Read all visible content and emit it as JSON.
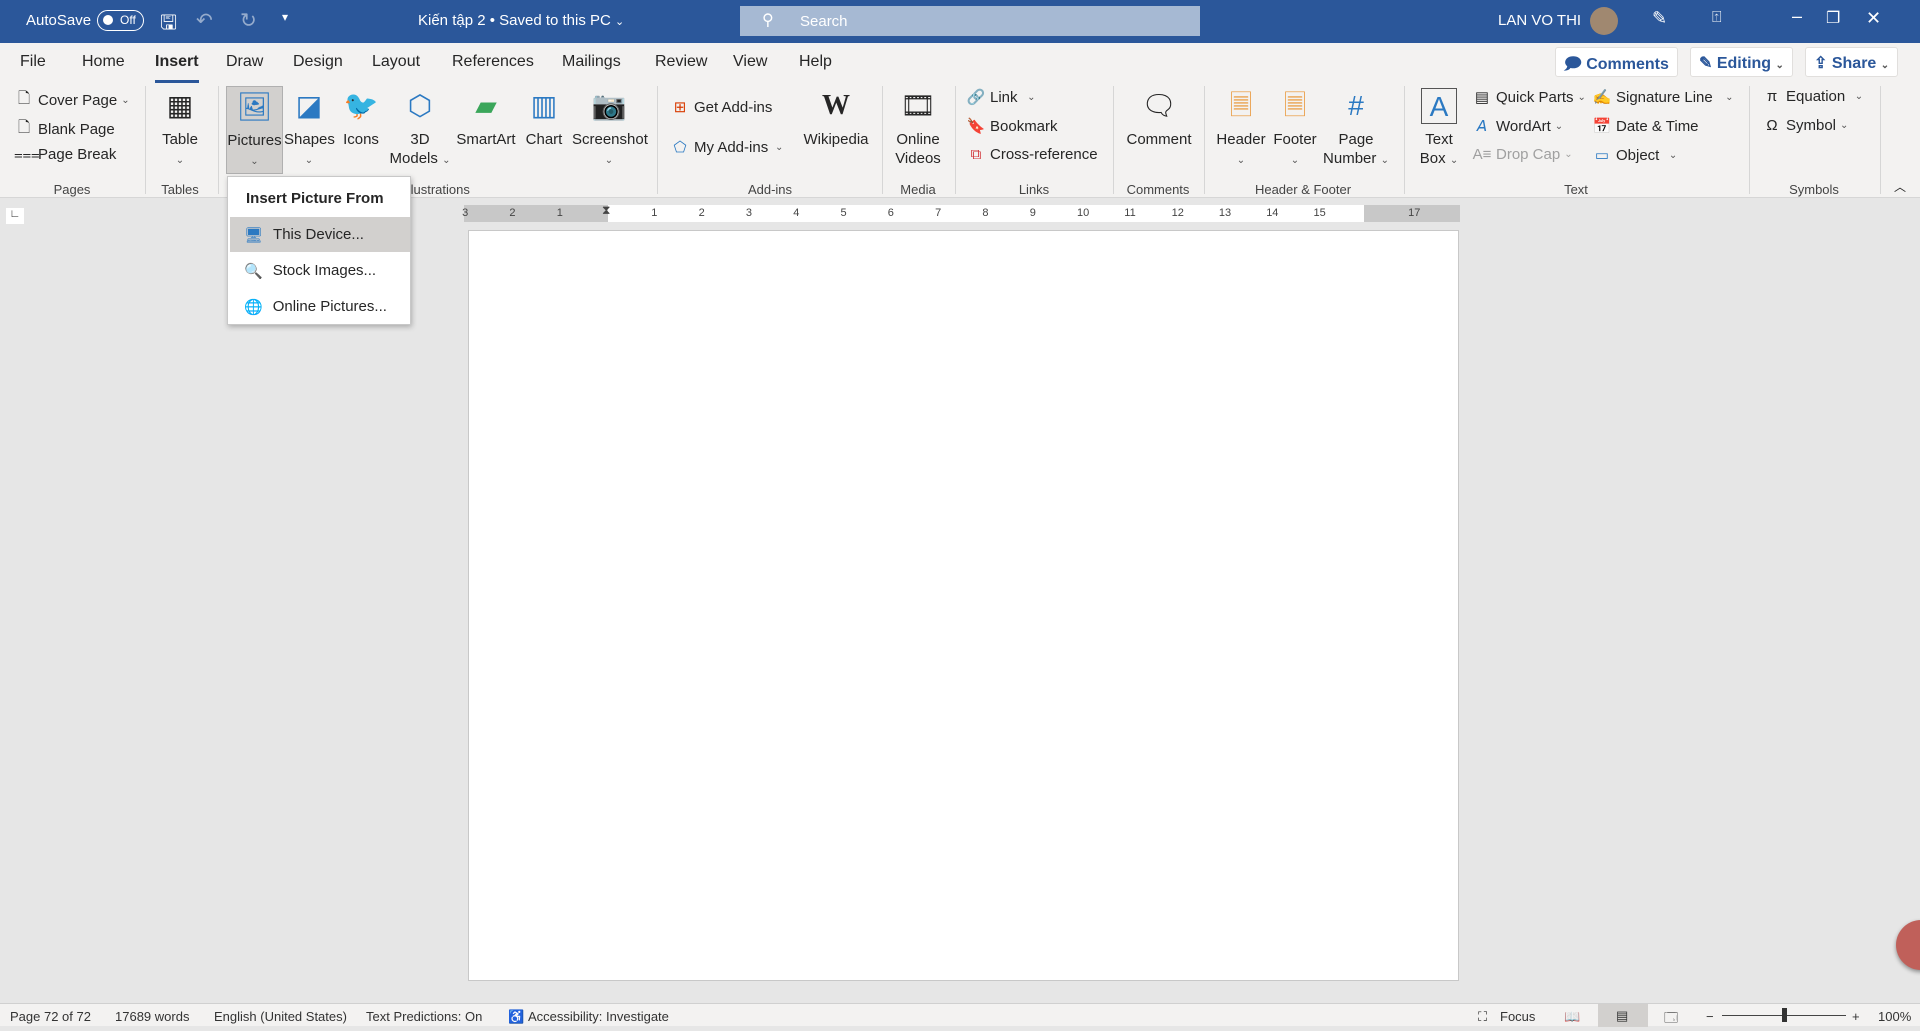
{
  "titlebar": {
    "autosave": "AutoSave",
    "autosave_state": "Off",
    "doc_title": "Kiến tập 2 • Saved to this PC",
    "search_placeholder": "Search",
    "user": "LAN VO THI",
    "color": "#2b579a"
  },
  "tabs": [
    "File",
    "Home",
    "Insert",
    "Draw",
    "Design",
    "Layout",
    "References",
    "Mailings",
    "Review",
    "View",
    "Help"
  ],
  "active_tab": "Insert",
  "top_buttons": {
    "comments": "Comments",
    "editing": "Editing",
    "share": "Share"
  },
  "ribbon": {
    "pages": {
      "label": "Pages",
      "cover": "Cover Page",
      "blank": "Blank Page",
      "break": "Page Break"
    },
    "tables": {
      "label": "Tables",
      "table": "Table"
    },
    "illustrations": {
      "label": "Illustrations",
      "pictures": "Pictures",
      "shapes": "Shapes",
      "icons": "Icons",
      "models_1": "3D",
      "models_2": "Models",
      "smartart": "SmartArt",
      "chart": "Chart",
      "screenshot": "Screenshot"
    },
    "addins": {
      "label": "Add-ins",
      "get": "Get Add-ins",
      "my": "My Add-ins",
      "wikipedia": "Wikipedia"
    },
    "media": {
      "label": "Media",
      "online_1": "Online",
      "online_2": "Videos"
    },
    "links": {
      "label": "Links",
      "link": "Link",
      "bookmark": "Bookmark",
      "cross": "Cross-reference"
    },
    "comments": {
      "label": "Comments",
      "comment": "Comment"
    },
    "header_footer": {
      "label": "Header & Footer",
      "header": "Header",
      "footer": "Footer",
      "page_1": "Page",
      "page_2": "Number"
    },
    "text": {
      "label": "Text",
      "textbox_1": "Text",
      "textbox_2": "Box",
      "quick_parts": "Quick Parts",
      "wordart": "WordArt",
      "drop_cap": "Drop Cap",
      "signature": "Signature Line",
      "datetime": "Date & Time",
      "object": "Object"
    },
    "symbols": {
      "label": "Symbols",
      "equation": "Equation",
      "symbol": "Symbol"
    }
  },
  "menu": {
    "title": "Insert Picture From",
    "items": [
      "This Device...",
      "Stock Images...",
      "Online Pictures..."
    ]
  },
  "ruler": [
    "3",
    "2",
    "1",
    "1",
    "2",
    "3",
    "4",
    "5",
    "6",
    "7",
    "8",
    "9",
    "10",
    "11",
    "12",
    "13",
    "14",
    "15",
    "17"
  ],
  "status": {
    "page": "Page 72 of 72",
    "words": "17689 words",
    "language": "English (United States)",
    "predictions": "Text Predictions: On",
    "accessibility": "Accessibility: Investigate",
    "focus": "Focus",
    "zoom": "100%",
    "zoom_level": 100
  }
}
